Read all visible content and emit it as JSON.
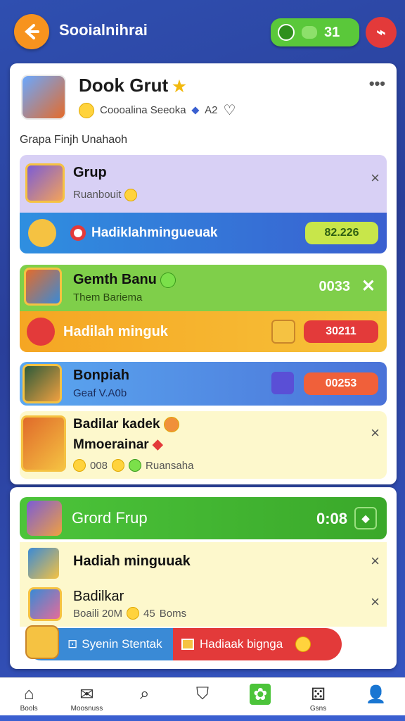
{
  "header": {
    "title": "Sooialnihrai",
    "score": "31"
  },
  "group": {
    "name": "Dook Grut",
    "meta_text": "Coooalina Seeoka",
    "meta_count": "A2",
    "section_label": "Grapa Finjh Unahaoh"
  },
  "rows": {
    "r1": {
      "title": "Grup",
      "sub": "Ruanbouit"
    },
    "r1_ribbon": {
      "label": "Hadiklahmingueuak",
      "value": "82.226"
    },
    "r2": {
      "title": "Gemth Banu",
      "sub": "Them Bariema",
      "value": "0033"
    },
    "r2_ribbon": {
      "label": "Hadilah minguk",
      "value": "30211"
    },
    "r3": {
      "title": "Bonpiah",
      "sub": "Geaf V.A0b",
      "value": "00253"
    },
    "r4": {
      "title": "Badilar kadek",
      "title2": "Mmoerainar",
      "sub_value": "008",
      "sub_text": "Ruansaha"
    }
  },
  "group2": {
    "title": "Grord Frup",
    "value": "0:08",
    "item1": {
      "title": "Hadiah minguuak"
    },
    "item2": {
      "title": "Badilkar",
      "sub": "Boaili 20M",
      "sub2": "45",
      "sub3": "Boms"
    },
    "action_left": "Syenin Stentak",
    "action_right": "Hadiaak bignga"
  },
  "nav": {
    "home": "Bools",
    "moments": "Moosnuss",
    "search": "",
    "shield": "",
    "active": "",
    "games": "Gsns",
    "profile": ""
  },
  "colors": {
    "accent_orange": "#f7931e",
    "accent_green": "#5ac83a",
    "accent_red": "#e33a3a"
  }
}
